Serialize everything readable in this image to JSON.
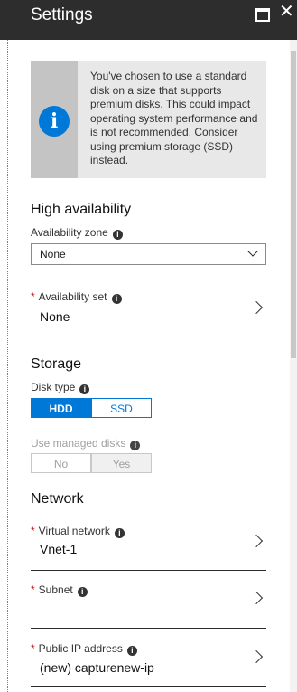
{
  "window": {
    "title": "Settings"
  },
  "info": {
    "message": "You've chosen to use a standard disk on a size that supports premium disks. This could impact operating system performance and is not recommended. Consider using premium storage (SSD) instead."
  },
  "high_availability": {
    "title": "High availability",
    "zone": {
      "label": "Availability zone",
      "value": "None"
    },
    "set": {
      "label": "Availability set",
      "value": "None"
    }
  },
  "storage": {
    "title": "Storage",
    "disk_type": {
      "label": "Disk type",
      "options": [
        "HDD",
        "SSD"
      ],
      "selected": "HDD"
    },
    "managed_disks": {
      "label": "Use managed disks",
      "options": [
        "No",
        "Yes"
      ],
      "selected": "Yes"
    }
  },
  "network": {
    "title": "Network",
    "virtual_network": {
      "label": "Virtual network",
      "value": "Vnet-1"
    },
    "subnet": {
      "label": "Subnet",
      "value": ""
    },
    "public_ip": {
      "label": "Public IP address",
      "value": "(new) capturenew-ip"
    }
  },
  "colors": {
    "accent": "#0078d7",
    "titlebar": "#2d2d2d",
    "required": "#c50f1f"
  }
}
